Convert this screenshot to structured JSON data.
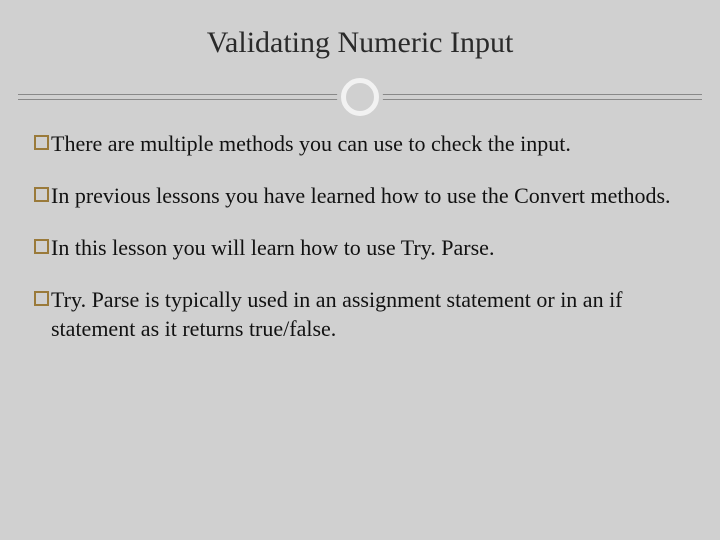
{
  "slide": {
    "title": "Validating Numeric Input",
    "bullets": [
      "There are multiple methods you can use to check the input.",
      "In previous lessons you have learned how to use the Convert methods.",
      "In this lesson you will learn how to use Try. Parse.",
      "Try. Parse is typically used in an assignment statement or in an if statement as it returns true/false."
    ]
  }
}
